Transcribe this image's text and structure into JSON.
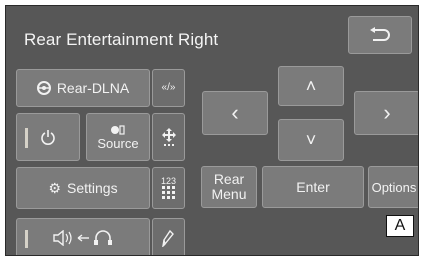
{
  "title": "Rear Entertainment Right",
  "back_icon": "return-arrow-icon",
  "source_selector": {
    "icon": "dlna-network-icon",
    "label": "Rear-DLNA"
  },
  "mode_toggle": {
    "label": "«/»"
  },
  "power": {
    "icon": "power-icon"
  },
  "source": {
    "icon": "source-icon",
    "label": "Source"
  },
  "move_icon": "move-arrows-icon",
  "settings": {
    "icon": "gear-icon",
    "label": "Settings"
  },
  "keypad": {
    "label": "123",
    "icon": "keypad-grid-icon"
  },
  "audio_route": {
    "icon": "speaker-to-headphone-icon",
    "arrow": "←"
  },
  "pen_icon": "pen-icon",
  "rear_menu": {
    "line1": "Rear",
    "line2": "Menu"
  },
  "enter": {
    "label": "Enter"
  },
  "options": {
    "label": "Options"
  },
  "dpad": {
    "up": "˄",
    "down": "˅",
    "left": "‹",
    "right": "›"
  },
  "marker": {
    "label": "A"
  }
}
